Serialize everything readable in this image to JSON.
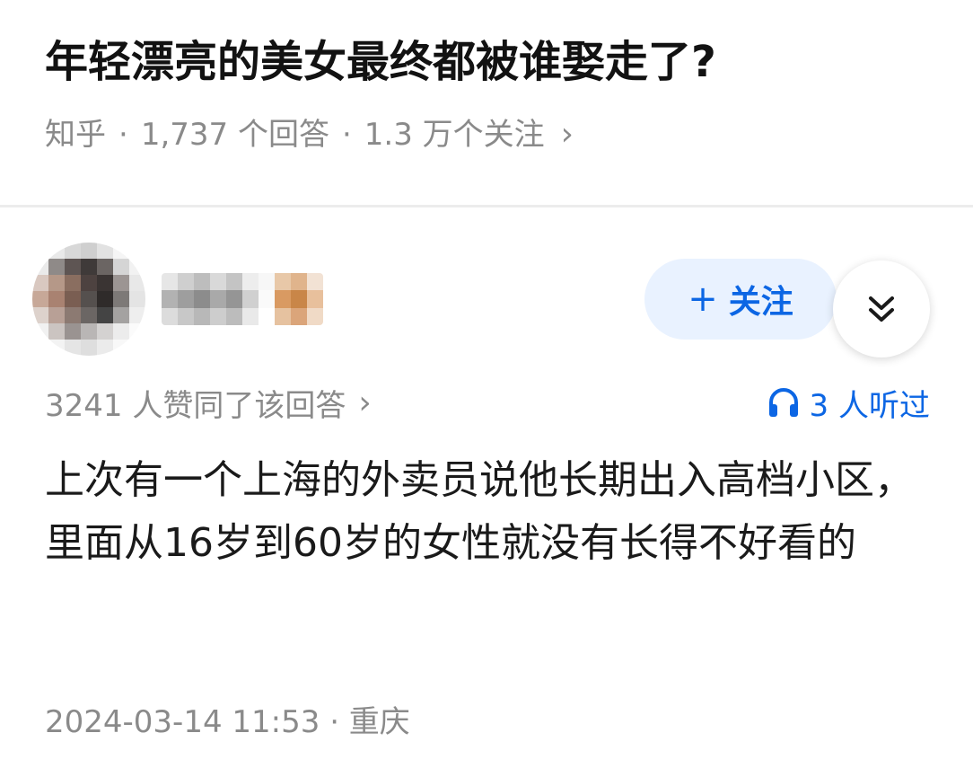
{
  "question": {
    "title": "年轻漂亮的美女最终都被谁娶走了?",
    "source": "知乎",
    "separator": "·",
    "answers_count": "1,737 个回答",
    "followers_count": "1.3 万个关注",
    "chevron": "›"
  },
  "author": {
    "avatar_icon": "blurred-avatar",
    "name_icon": "blurred-username",
    "follow_label": "关注",
    "follow_icon": "plus-icon",
    "expand_icon": "double-chevron-down-icon"
  },
  "answer": {
    "upvotes": "3241 人赞同了该回答",
    "upvotes_chevron": "›",
    "listeners": "3 人听过",
    "listeners_icon": "headphones-icon",
    "body": "上次有一个上海的外卖员说他长期出入高档小区，里面从16岁到60岁的女性就没有长得不好看的",
    "timestamp": "2024-03-14 11:53 · 重庆"
  },
  "colors": {
    "accent": "#0c66e4",
    "follow_bg": "#e9f2ff",
    "muted_text": "#8a8a8a",
    "divider": "#ececec"
  }
}
